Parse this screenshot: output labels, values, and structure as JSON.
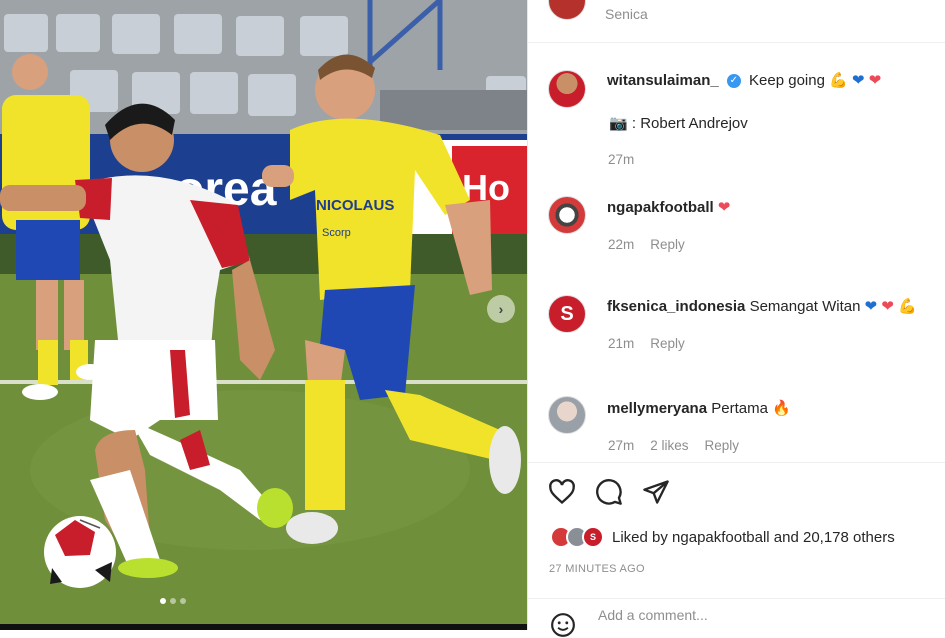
{
  "post": {
    "location": "Senica"
  },
  "caption": {
    "username": "witansulaiman_",
    "text": "Keep going",
    "credit": ": Robert Andrejov",
    "time": "27m"
  },
  "comments": [
    {
      "username": "ngapakfootball",
      "text": "",
      "time": "22m",
      "likes": "",
      "reply": "Reply"
    },
    {
      "username": "fksenica_indonesia",
      "text": "Semangat Witan",
      "time": "21m",
      "likes": "",
      "reply": "Reply"
    },
    {
      "username": "mellymeryana",
      "text": "Pertama",
      "time": "27m",
      "likes": "2 likes",
      "reply": "Reply"
    }
  ],
  "liked_by": {
    "text": "Liked by ngapakfootball and 20,178 others"
  },
  "timestamp": "27 MINUTES AGO",
  "add_comment": {
    "placeholder": "Add a comment..."
  },
  "icons": [
    "heart-icon",
    "comment-icon",
    "share-icon",
    "emoji-icon",
    "verified-icon",
    "camera-icon",
    "chevron-right-icon"
  ],
  "colors": {
    "accent_blue": "#3897f0",
    "heart_red": "#ed4956",
    "muted": "#8e8e8e",
    "text": "#262626"
  }
}
